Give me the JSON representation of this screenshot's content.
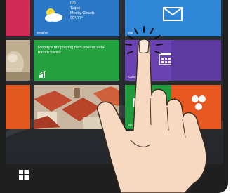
{
  "tiles": {
    "weather": {
      "label": "Weather",
      "temp": "0/0",
      "city": "Taipei",
      "condition": "Mostly Clouds",
      "range": "90°/77°",
      "icon": "partly-cloudy-icon"
    },
    "mail": {
      "label": "Mail",
      "icon": "envelope-icon"
    },
    "finance": {
      "headline": "Moody's tits playing field toward safe-haven banks",
      "icon": "finance-chart-icon"
    },
    "calendar": {
      "label": "Calendar",
      "icon": "calendar-grid-icon"
    },
    "green": {
      "label": "Store Ut",
      "icon": "store-bag-icon"
    },
    "orange": {
      "icon": "music-icon"
    }
  },
  "taskbar": {
    "start_icon": "windows-logo-icon"
  },
  "gesture": {
    "type": "tap",
    "target": "calendar-tile",
    "icon": "pointing-hand-icon"
  },
  "colors": {
    "weather": "#2b79c6",
    "mail": "#2f85d6",
    "finance": "#23a23f",
    "calendar": "#6b42b2",
    "green_tile": "#1f9b3b",
    "orange_tile": "#e8571f",
    "red_tile": "#cf2a55",
    "bezel": "#1f1f1f"
  }
}
